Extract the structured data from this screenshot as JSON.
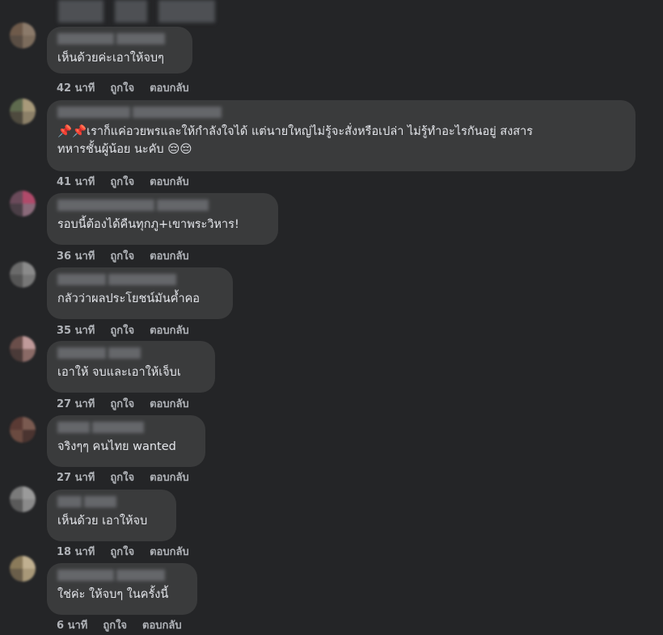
{
  "comments": [
    {
      "text": "เห็นด้วยค่ะเอาให้จบๆ",
      "time": "42 นาที",
      "like_label": "ถูกใจ",
      "reply_label": "ตอบกลับ"
    },
    {
      "text": "📌📌เราก็แค่อวยพรและให้กำลังใจได้ แต่นายใหญ่ไม่รู้จะสั่งหรือเปล่า ไม่รู้ทำอะไรกันอยู่ สงสาร\nทหารชั้นผู้น้อย นะคับ 😔😔",
      "time": "41 นาที",
      "like_label": "ถูกใจ",
      "reply_label": "ตอบกลับ"
    },
    {
      "text": "รอบนี้ต้องได้คืนทุกภู+เขาพระวิหาร!",
      "time": "36 นาที",
      "like_label": "ถูกใจ",
      "reply_label": "ตอบกลับ"
    },
    {
      "text": "กลัวว่าผลประโยชน์มันค้ำคอ",
      "time": "35 นาที",
      "like_label": "ถูกใจ",
      "reply_label": "ตอบกลับ"
    },
    {
      "text": "เอาให้ จบและเอาให้เจ็บเ",
      "time": "27 นาที",
      "like_label": "ถูกใจ",
      "reply_label": "ตอบกลับ"
    },
    {
      "text": "จริงๆๆ คนไทย wanted",
      "time": "27 นาที",
      "like_label": "ถูกใจ",
      "reply_label": "ตอบกลับ"
    },
    {
      "text": "เห็นด้วย เอาให้จบ",
      "time": "18 นาที",
      "like_label": "ถูกใจ",
      "reply_label": "ตอบกลับ"
    },
    {
      "text": "ใช่ค่ะ ให้จบๆ ในครั้งนี้",
      "time": "6 นาที",
      "like_label": "ถูกใจ",
      "reply_label": "ตอบกลับ"
    }
  ]
}
